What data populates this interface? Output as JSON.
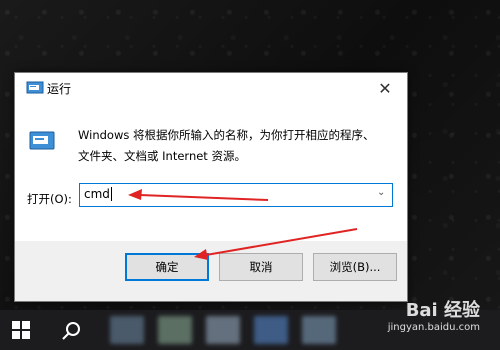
{
  "window": {
    "title": "运行",
    "description_line1": "Windows 将根据你所输入的名称，为你打开相应的程序、",
    "description_line2": "文件夹、文档或 Internet 资源。",
    "open_label": "打开(O):",
    "input_value": "cmd",
    "ok_label": "确定",
    "cancel_label": "取消",
    "browse_label": "浏览(B)..."
  },
  "watermark": {
    "main": "Bai 经验",
    "sub": "jingyan.baidu.com"
  },
  "colors": {
    "accent": "#0078d7",
    "annotation_arrow": "#e02424"
  },
  "icons": [
    "run-app-icon",
    "close-icon",
    "chevron-down-icon",
    "windows-start-icon",
    "search-icon"
  ]
}
